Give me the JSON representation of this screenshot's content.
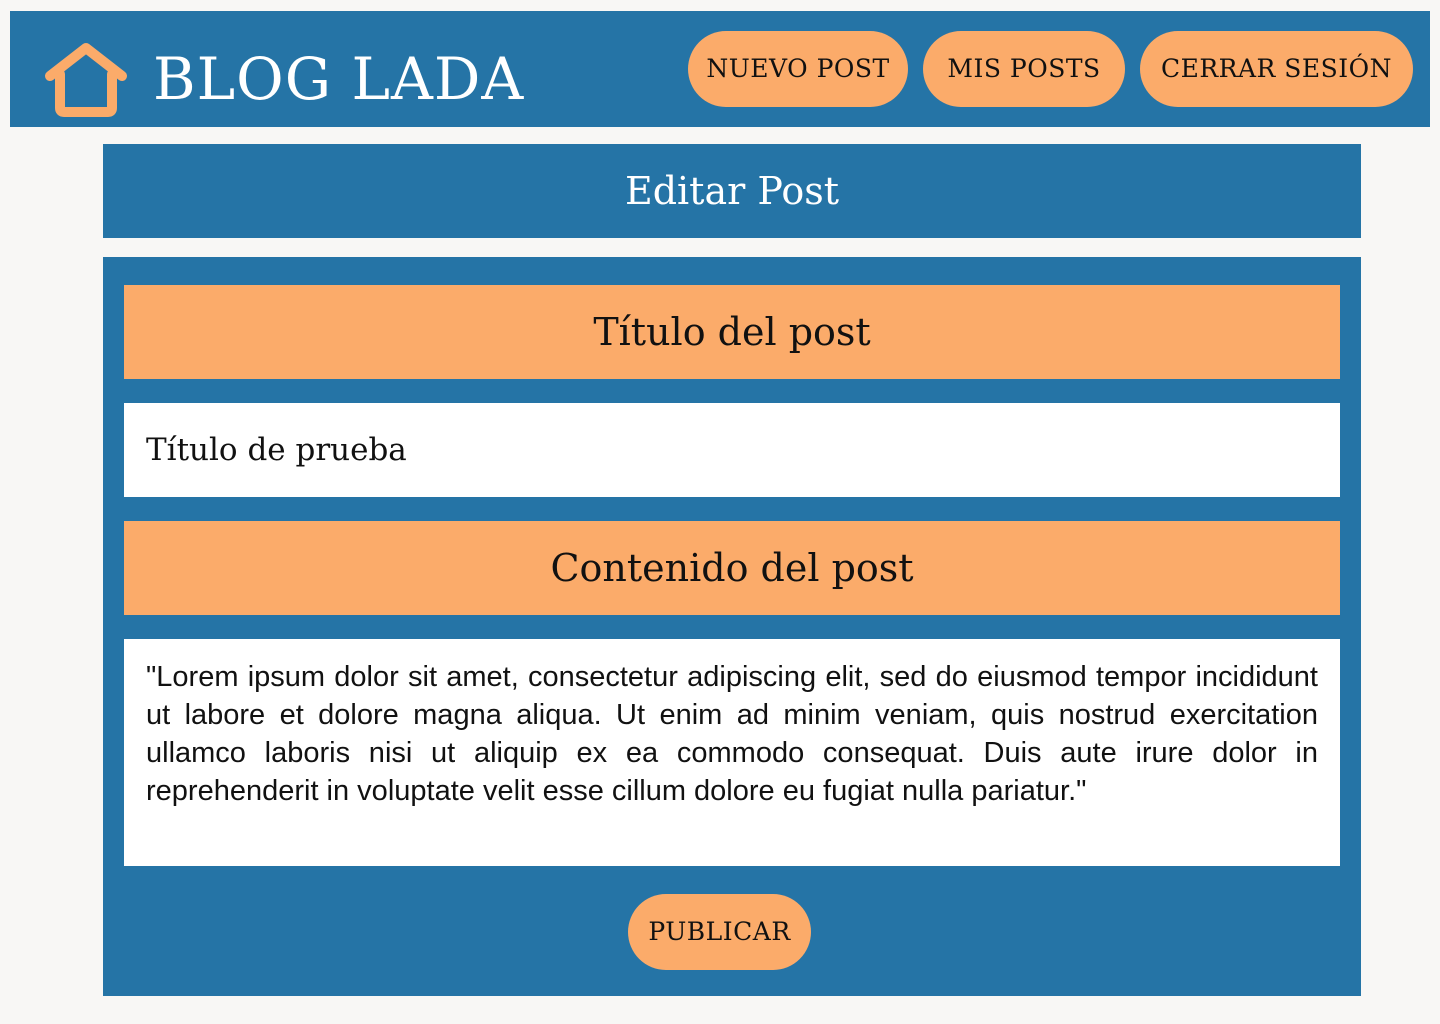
{
  "header": {
    "brand": "BLOG LADA",
    "home_icon": "home-icon",
    "nav": {
      "new_post": "NUEVO POST",
      "my_posts": "MIS POSTS",
      "logout": "CERRAR SESIÓN"
    }
  },
  "page": {
    "title": "Editar Post"
  },
  "form": {
    "title_label": "Título del post",
    "title_value": "Título de prueba",
    "content_label": "Contenido del post",
    "content_value": "\"Lorem ipsum dolor sit amet, consectetur adipiscing elit, sed do eiusmod tempor incididunt ut labore et dolore magna aliqua. Ut enim ad minim veniam, quis nostrud exercitation ullamco laboris nisi ut aliquip ex ea commodo consequat. Duis aute irure dolor in reprehenderit in voluptate velit esse cillum dolore eu fugiat nulla pariatur.\"",
    "submit_label": "PUBLICAR"
  },
  "colors": {
    "primary": "#2574a6",
    "accent": "#fbab6a",
    "background": "#f8f7f5",
    "input_background": "#ffffff"
  }
}
